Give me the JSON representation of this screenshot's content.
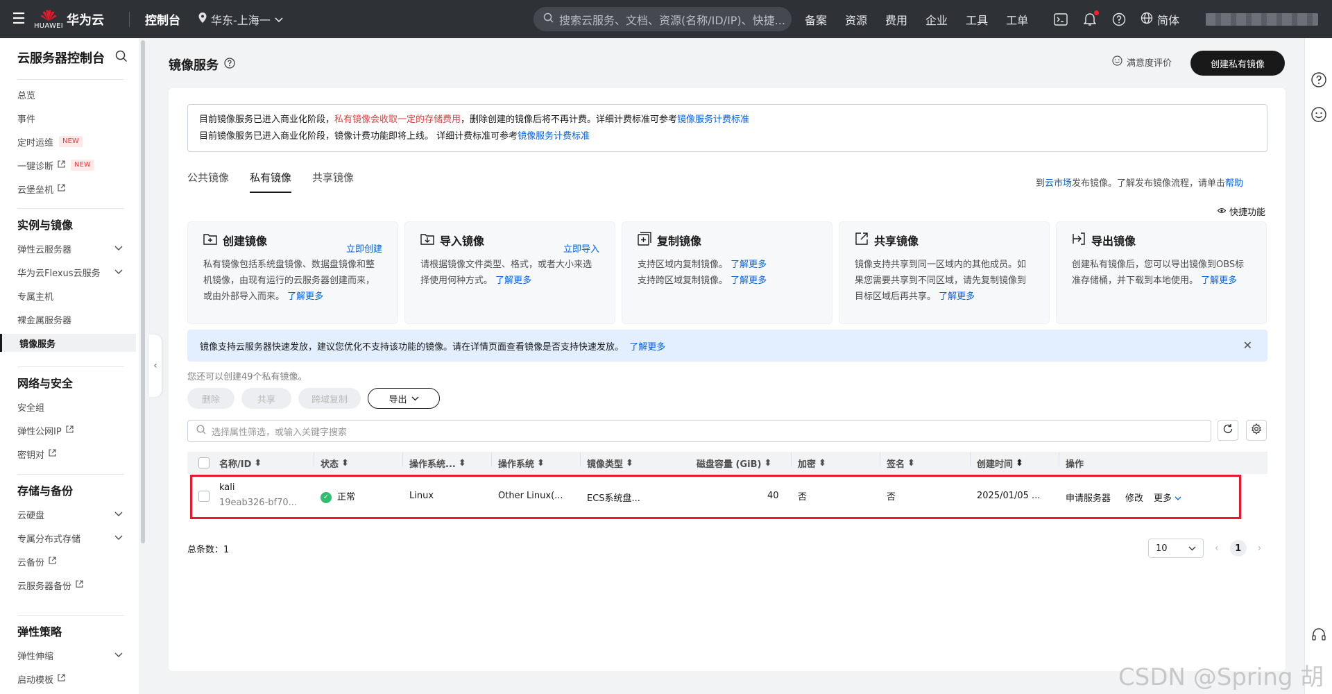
{
  "topbar": {
    "logo_brand": "HUAWEI",
    "logo_title": "华为云",
    "console": "控制台",
    "region": "华东-上海一",
    "search_placeholder": "搜索云服务、文档、资源(名称/ID/IP)、快捷...",
    "links": [
      "备案",
      "资源",
      "费用",
      "企业",
      "工具",
      "工单"
    ],
    "language": "简体"
  },
  "sidebar": {
    "title": "云服务器控制台",
    "top_items": [
      {
        "label": "总览"
      },
      {
        "label": "事件"
      },
      {
        "label": "定时运维",
        "badge": "NEW"
      },
      {
        "label": "一键诊断",
        "badge": "NEW"
      },
      {
        "label": "云堡垒机"
      }
    ],
    "groups": [
      {
        "title": "实例与镜像",
        "items": [
          "弹性云服务器",
          "华为云Flexus云服务",
          "专属主机",
          "裸金属服务器",
          "镜像服务"
        ]
      },
      {
        "title": "网络与安全",
        "items": [
          "安全组",
          "弹性公网IP",
          "密钥对"
        ]
      },
      {
        "title": "存储与备份",
        "items": [
          "云硬盘",
          "专属分布式存储",
          "云备份",
          "云服务器备份"
        ]
      },
      {
        "title": "弹性策略",
        "items": [
          "弹性伸缩",
          "启动模板"
        ]
      }
    ]
  },
  "header": {
    "title": "镜像服务",
    "satisfaction": "满意度评价",
    "create_button": "创建私有镜像"
  },
  "notice": {
    "line1_prefix": "目前镜像服务已进入商业化阶段，",
    "line1_red": "私有镜像会收取一定的存储费用",
    "line1_mid": "，删除创建的镜像后将不再计费。详细计费标准可参考",
    "line1_link": "镜像服务计费标准",
    "line2_prefix": "目前镜像服务已进入商业化阶段，镜像计费功能即将上线。 详细计费标准可参考",
    "line2_link": "镜像服务计费标准"
  },
  "tabs": [
    "公共镜像",
    "私有镜像",
    "共享镜像"
  ],
  "active_tab": "私有镜像",
  "tab_right": {
    "prefix": "到",
    "link1": "云市场",
    "mid": "发布镜像。了解发布镜像流程，请单击",
    "link2": "帮助"
  },
  "quick_label": "快捷功能",
  "cards": [
    {
      "title": "创建镜像",
      "action": "立即创建",
      "text": "私有镜像包括系统盘镜像、数据盘镜像和整机镜像，由现有运行的云服务器创建而来，或由外部导入而来。",
      "link": "了解更多"
    },
    {
      "title": "导入镜像",
      "action": "立即导入",
      "text": "请根据镜像文件类型、格式，或者大小来选择使用何种方式。",
      "link": "了解更多"
    },
    {
      "title": "复制镜像",
      "action": "",
      "text_lines": [
        "支持区域内复制镜像。",
        "支持跨区域复制镜像。"
      ],
      "link": "了解更多"
    },
    {
      "title": "共享镜像",
      "action": "",
      "text": "镜像支持共享到同一区域内的其他成员。如果您需要共享到不同区域，请先复制镜像到目标区域后再共享。",
      "link": "了解更多"
    },
    {
      "title": "导出镜像",
      "action": "",
      "text": "创建私有镜像后，您可以导出镜像到OBS标准存储桶，并下载到本地使用。",
      "link": "了解更多"
    }
  ],
  "info_bar": {
    "text": "镜像支持云服务器快速发放，建议您优化不支持该功能的镜像。请在详情页面查看镜像是否支持快速发放。",
    "link": "了解更多"
  },
  "quota_hint": "您还可以创建49个私有镜像。",
  "toolbar": {
    "delete": "删除",
    "share": "共享",
    "cross_copy": "跨域复制",
    "export": "导出"
  },
  "filter_placeholder": "选择属性筛选，或输入关键字搜索",
  "table": {
    "columns": [
      "名称/ID",
      "状态",
      "操作系统...",
      "操作系统",
      "镜像类型",
      "磁盘容量 (GiB)",
      "加密",
      "签名",
      "创建时间",
      "操作"
    ],
    "rows": [
      {
        "name": "kali",
        "id": "19eab326-bf70...",
        "status": "正常",
        "os_type": "Linux",
        "os": "Other Linux(...",
        "image_type": "ECS系统盘...",
        "disk": "40",
        "encrypted": "否",
        "signed": "否",
        "created": "2025/01/05 ...",
        "actions": [
          "申请服务器",
          "修改",
          "更多"
        ]
      }
    ]
  },
  "pagination": {
    "total_label": "总条数：",
    "total": "1",
    "page_size": "10",
    "current_page": "1"
  },
  "watermark": "CSDN @Spring  胡",
  "colors": {
    "accent": "#0062e6",
    "highlight_border": "#e8192c",
    "topbar": "#2e3136",
    "status_ok": "#2fbf71"
  }
}
